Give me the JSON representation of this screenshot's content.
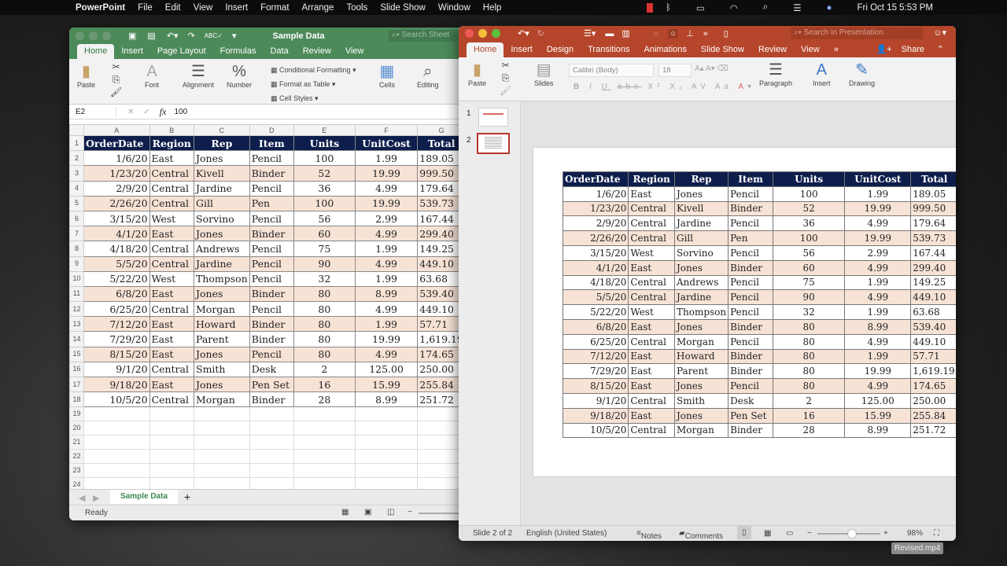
{
  "menubar": {
    "app": "PowerPoint",
    "items": [
      "File",
      "Edit",
      "View",
      "Insert",
      "Format",
      "Arrange",
      "Tools",
      "Slide Show",
      "Window",
      "Help"
    ],
    "clock": "Fri Oct 15  5:53 PM"
  },
  "excel": {
    "title": "Sample Data",
    "search_placeholder": "Search Sheet",
    "tabs": [
      "Home",
      "Insert",
      "Page Layout",
      "Formulas",
      "Data",
      "Review",
      "View"
    ],
    "ribbon": {
      "paste": "Paste",
      "font": "Font",
      "alignment": "Alignment",
      "number": "Number",
      "conditional": "Conditional Formatting",
      "format_table": "Format as Table",
      "cell_styles": "Cell Styles",
      "cells": "Cells",
      "editing": "Editing"
    },
    "name_box": "E2",
    "formula_value": "100",
    "fx": "fx",
    "columns": [
      "A",
      "B",
      "C",
      "D",
      "E",
      "F",
      "G"
    ],
    "empty_rows": [
      "19",
      "20",
      "21",
      "22",
      "23",
      "24",
      "25"
    ],
    "sheet_tab": "Sample Data",
    "status": "Ready",
    "colors": {
      "accent": "#4d8a59"
    }
  },
  "powerpoint": {
    "search_placeholder": "Search in Presentation",
    "tabs": [
      "Home",
      "Insert",
      "Design",
      "Transitions",
      "Animations",
      "Slide Show",
      "Review",
      "View"
    ],
    "share": "Share",
    "ribbon": {
      "paste": "Paste",
      "slides": "Slides",
      "font_name": "Calibri (Body)",
      "font_size": "18",
      "paragraph": "Paragraph",
      "insert": "Insert",
      "drawing": "Drawing"
    },
    "slide_numbers": [
      "1",
      "2"
    ],
    "status": {
      "slide": "Slide 2 of 2",
      "language": "English (United States)",
      "notes": "Notes",
      "comments": "Comments",
      "zoom": "98%"
    },
    "zoom_level": 0.55,
    "colors": {
      "accent": "#b5462b"
    }
  },
  "table": {
    "headers": [
      "OrderDate",
      "Region",
      "Rep",
      "Item",
      "Units",
      "UnitCost",
      "Total"
    ],
    "rows": [
      [
        "1/6/20",
        "East",
        "Jones",
        "Pencil",
        "100",
        "1.99",
        "189.05"
      ],
      [
        "1/23/20",
        "Central",
        "Kivell",
        "Binder",
        "52",
        "19.99",
        "999.50"
      ],
      [
        "2/9/20",
        "Central",
        "Jardine",
        "Pencil",
        "36",
        "4.99",
        "179.64"
      ],
      [
        "2/26/20",
        "Central",
        "Gill",
        "Pen",
        "100",
        "19.99",
        "539.73"
      ],
      [
        "3/15/20",
        "West",
        "Sorvino",
        "Pencil",
        "56",
        "2.99",
        "167.44"
      ],
      [
        "4/1/20",
        "East",
        "Jones",
        "Binder",
        "60",
        "4.99",
        "299.40"
      ],
      [
        "4/18/20",
        "Central",
        "Andrews",
        "Pencil",
        "75",
        "1.99",
        "149.25"
      ],
      [
        "5/5/20",
        "Central",
        "Jardine",
        "Pencil",
        "90",
        "4.99",
        "449.10"
      ],
      [
        "5/22/20",
        "West",
        "Thompson",
        "Pencil",
        "32",
        "1.99",
        "63.68"
      ],
      [
        "6/8/20",
        "East",
        "Jones",
        "Binder",
        "80",
        "8.99",
        "539.40"
      ],
      [
        "6/25/20",
        "Central",
        "Morgan",
        "Pencil",
        "80",
        "4.99",
        "449.10"
      ],
      [
        "7/12/20",
        "East",
        "Howard",
        "Binder",
        "80",
        "1.99",
        "57.71"
      ],
      [
        "7/29/20",
        "East",
        "Parent",
        "Binder",
        "80",
        "19.99",
        "1,619.19"
      ],
      [
        "8/15/20",
        "East",
        "Jones",
        "Pencil",
        "80",
        "4.99",
        "174.65"
      ],
      [
        "9/1/20",
        "Central",
        "Smith",
        "Desk",
        "2",
        "125.00",
        "250.00"
      ],
      [
        "9/18/20",
        "East",
        "Jones",
        "Pen Set",
        "16",
        "15.99",
        "255.84"
      ],
      [
        "10/5/20",
        "Central",
        "Morgan",
        "Binder",
        "28",
        "8.99",
        "251.72"
      ]
    ],
    "colors": {
      "header": "#0d1e4c",
      "stripe": "#f7e3d6"
    }
  },
  "tooltip": "Revised.mp4"
}
